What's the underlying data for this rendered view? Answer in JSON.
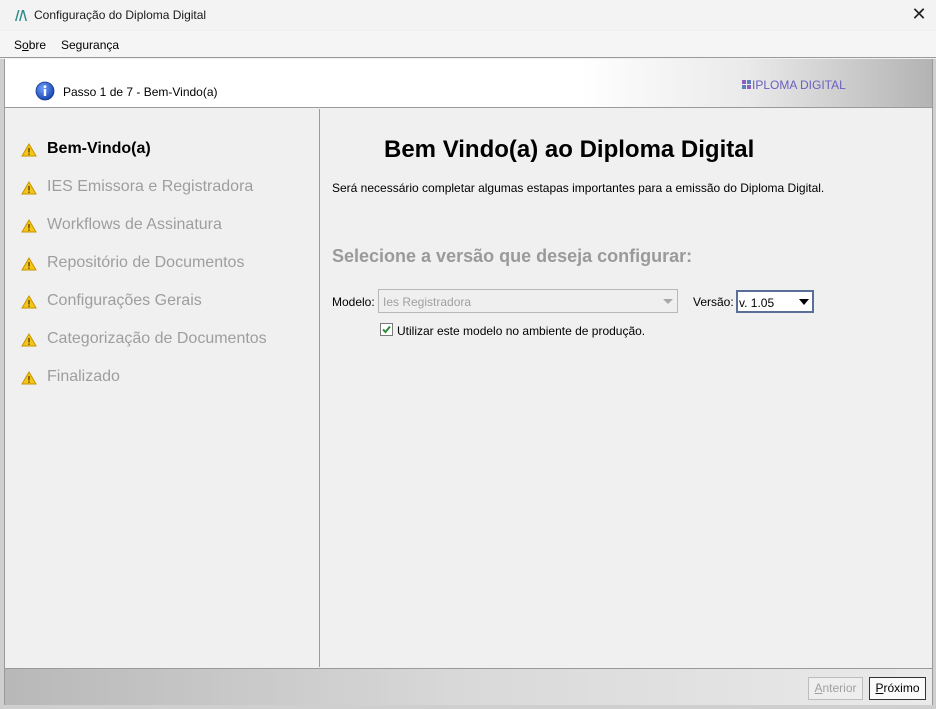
{
  "window": {
    "title": "Configuração do Diploma Digital",
    "close_glyph": "✕"
  },
  "menu": {
    "items": [
      {
        "label": "Sobre",
        "mnemonic_index": 1
      },
      {
        "label": "Segurança"
      }
    ]
  },
  "header": {
    "step_text": "Passo 1 de 7 - Bem-Vindo(a)",
    "brand_text": "DIPLOMA DIGITAL",
    "info_icon": "info-icon"
  },
  "sidebar": {
    "items": [
      {
        "label": "Bem-Vindo(a)",
        "active": true,
        "icon": "warning-icon"
      },
      {
        "label": "IES Emissora e Registradora",
        "active": false,
        "icon": "warning-icon"
      },
      {
        "label": "Workflows de Assinatura",
        "active": false,
        "icon": "warning-icon"
      },
      {
        "label": "Repositório de Documentos",
        "active": false,
        "icon": "warning-icon"
      },
      {
        "label": "Configurações Gerais",
        "active": false,
        "icon": "warning-icon"
      },
      {
        "label": "Categorização de Documentos",
        "active": false,
        "icon": "warning-icon"
      },
      {
        "label": "Finalizado",
        "active": false,
        "icon": "warning-icon"
      }
    ]
  },
  "main": {
    "heading": "Bem Vindo(a) ao Diploma Digital",
    "description": "Será necessário completar algumas estapas importantes para a emissão do Diploma Digital.",
    "subheading": "Selecione a versão que deseja configurar:",
    "modelo": {
      "label": "Modelo:",
      "value": "Ies Registradora",
      "enabled": false
    },
    "versao": {
      "label": "Versão:",
      "value": "v. 1.05"
    },
    "producao_checkbox": {
      "label": "Utilizar este modelo no ambiente de produção.",
      "checked": true
    }
  },
  "footer": {
    "anterior_label": "Anterior",
    "anterior_enabled": false,
    "proximo_label": "Próximo"
  },
  "colors": {
    "warning_yellow": "#f5c518",
    "info_blue": "#1f5bc4",
    "brand_purple": "#6a5fbf",
    "check_green": "#2e8b3a"
  }
}
